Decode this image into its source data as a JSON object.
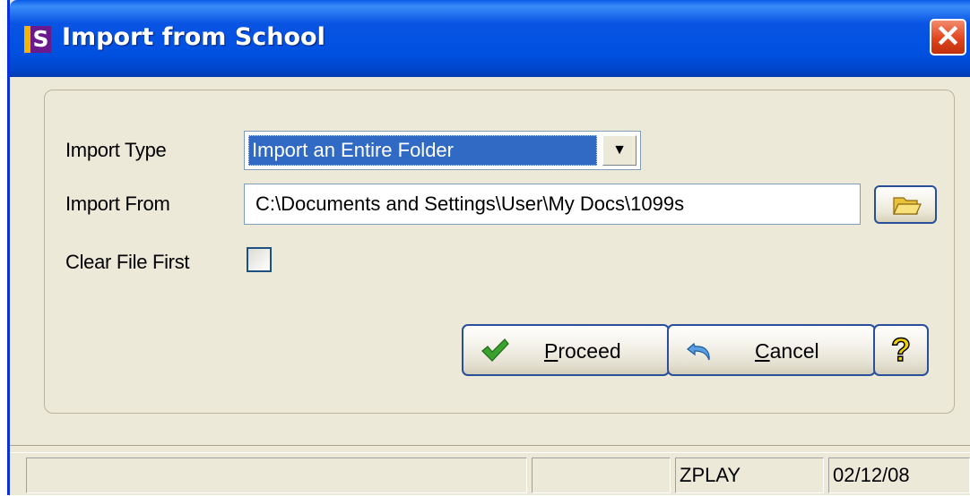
{
  "window": {
    "app_icon_letter": "S",
    "title": "Import from School",
    "close_glyph": "✕"
  },
  "form": {
    "import_type_label": "Import Type",
    "import_type_value": "Import an Entire Folder",
    "import_from_label": "Import From",
    "import_from_value": "C:\\Documents and Settings\\User\\My Docs\\1099s",
    "clear_file_label": "Clear File First",
    "clear_file_checked": false
  },
  "buttons": {
    "proceed_label": "Proceed",
    "cancel_label": "Cancel",
    "help_label": "?"
  },
  "icons": {
    "browse": "folder-icon",
    "proceed": "checkmark-icon",
    "cancel": "undo-arrow-icon",
    "help": "question-mark-icon",
    "dropdown": "chevron-down-icon"
  },
  "statusbar": {
    "panel1": "",
    "panel2": "",
    "user": "ZPLAY",
    "date": "02/12/08"
  },
  "colors": {
    "titlebar": "#0054e3",
    "selection": "#316ac5",
    "close": "#e0451d",
    "checkmark": "#3aa12e"
  }
}
